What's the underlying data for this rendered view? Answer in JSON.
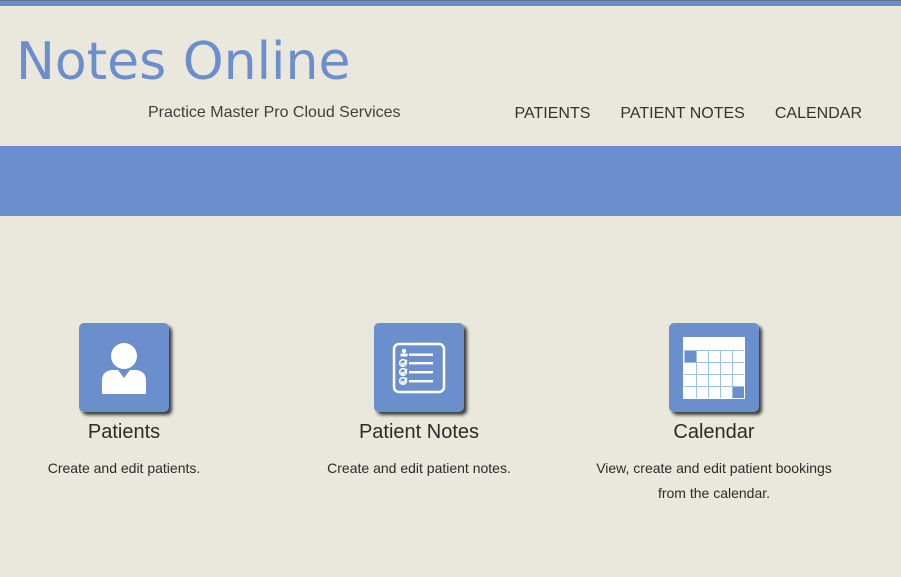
{
  "header": {
    "title": "Notes Online",
    "subtitle": "Practice Master Pro Cloud Services"
  },
  "nav": {
    "items": [
      {
        "label": "PATIENTS"
      },
      {
        "label": "PATIENT NOTES"
      },
      {
        "label": "CALENDAR"
      }
    ]
  },
  "colors": {
    "accent": "#6A8FCC",
    "background": "#EAE7DD",
    "text": "#2B2B2B"
  },
  "features": [
    {
      "icon": "user-icon",
      "title": "Patients",
      "description": "Create and edit patients."
    },
    {
      "icon": "checklist-icon",
      "title": "Patient Notes",
      "description": "Create and edit patient notes."
    },
    {
      "icon": "calendar-icon",
      "title": "Calendar",
      "description": "View, create and edit patient bookings from the calendar."
    }
  ]
}
